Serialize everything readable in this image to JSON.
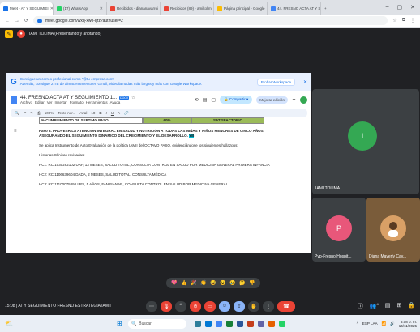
{
  "browser": {
    "tabs": [
      {
        "label": "Meet - AT Y SEGUIMIEI",
        "color": "#1a73e8",
        "active": true
      },
      {
        "label": "(17) WhatsApp",
        "color": "#25d366"
      },
      {
        "label": "Recibidos - diananavarroi",
        "color": "#ea4335"
      },
      {
        "label": "Recibidos (89) - amiltolim",
        "color": "#ea4335"
      },
      {
        "label": "Página principal - Google",
        "color": "#fbbc04"
      },
      {
        "label": "44. FRESNO ACTA AT Y S",
        "color": "#4285f4"
      }
    ],
    "new_tab": "+",
    "url": "meet.google.com/wxq-xwo-qrz?authuser=2"
  },
  "meet": {
    "presenting_label": "IAMI TOLIMA (Presentando y anotando)",
    "meeting_info": "15:08 | AT Y SEGUIMIENTO FRESNO ESTRATEGIA IAMII",
    "reactions": [
      "💖",
      "👍",
      "🎉",
      "👏",
      "😂",
      "😮",
      "😢",
      "🤔",
      "👎"
    ],
    "participants": [
      {
        "name": "IAMI TOLIMA",
        "initial": "I",
        "color": "#34a853"
      },
      {
        "name": "Pyp-Fresno Hospit...",
        "initial": "P",
        "color": "#e8577a"
      },
      {
        "name": "Diana Mayerly Cav...",
        "initial": "",
        "color": "#d9a066"
      }
    ],
    "participant_count": "4"
  },
  "doc": {
    "banner_line1": "Consigue un correo profesional como \"@tu-empresa.com\"",
    "banner_line2": "Además, consigue 2 TB de almacenamiento en Gmail, videollamadas más largas y más con Google Workspace.",
    "banner_button": "Probar Workspace",
    "title": "44. FRESNO ACTA AT Y SEGUIMIENTO 1...",
    "badge": "DOCX",
    "menus": [
      "Archivo",
      "Editar",
      "Ver",
      "Insertar",
      "Formato",
      "Herramientas",
      "Ayuda"
    ],
    "share_label": "Compartir",
    "improve_label": "Mejorar edición",
    "toolbar": {
      "zoom": "100%",
      "style": "Texto nor...",
      "font": "Arial",
      "size": "10"
    },
    "table_row": [
      "% CUMPLIMIENTO DE SEPTIMO PASO",
      "60%",
      "SATISFACTORIO"
    ],
    "step_heading": "Paso 8. PROVEER LA ATENCIÓN INTEGRAL EN SALUD Y NUTRICIÓN A TODAS LAS NIÑAS Y NIÑOS MENORES DE CINCO AÑOS, ASEGURANDO EL SEGUIMIENTO DINÁMICO DEL CRECIMIENTO Y EL DESARROLLO.",
    "step_tag": "YB",
    "para1": "Se aplica Instrumento de Auto Evaluación de la política IAMII del OCTAVO PASO, evidenciándose los siguientes hallazgos:",
    "para2": "Historias Clínicas revisadas:",
    "hc1": "HC1: RC 1030292102 URF, 13 MESES, SALUD TOTAL, CONSULTA CONTROL EN SALUD POR MEDICINA GENERAL PRIMERA INFANCIA",
    "hc2": "HC2: RC 1106639604 DADA, 2 MESES, SALUD TOTAL, CONSULTA MÉDICA",
    "hc3": "HC3: RC 1110007589 LLRS, 5 AÑOS, FAMISANAR, CONSULTA CONTROL EN SALUD POR MEDICINA GENERAL"
  },
  "taskbar": {
    "search_placeholder": "Buscar",
    "weather": "23°C",
    "lang": "ESP LAA",
    "time": "3:08 p. m.",
    "date": "14/11/2025"
  }
}
